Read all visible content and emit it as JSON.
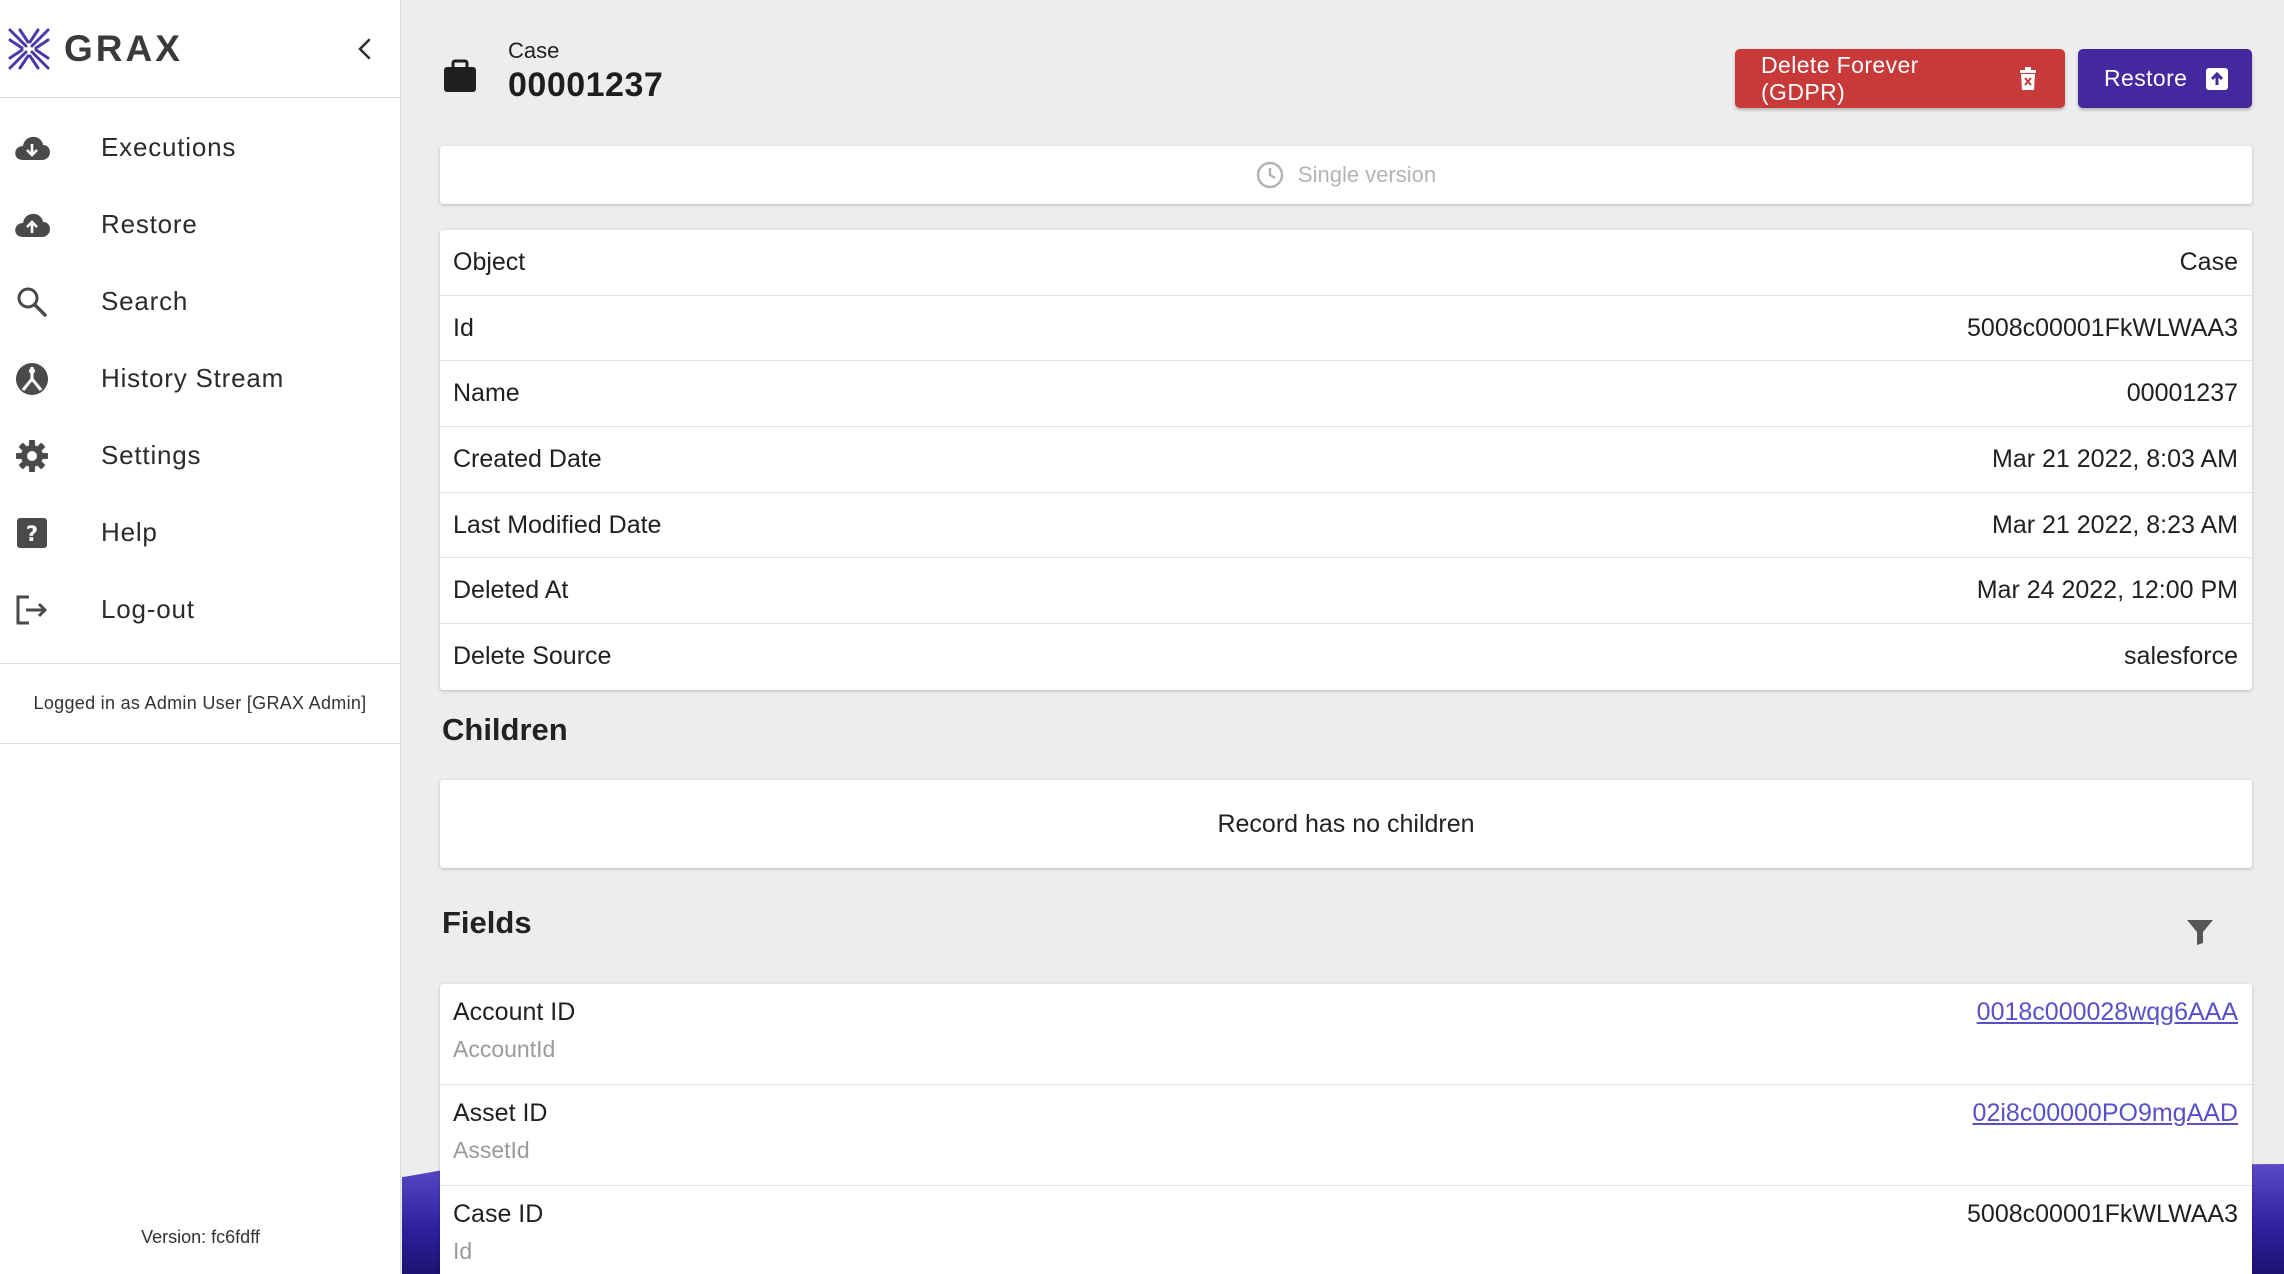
{
  "app": {
    "name": "GRAX",
    "collapse_icon": "chevron-left-icon"
  },
  "nav": {
    "items": [
      {
        "label": "Executions",
        "icon": "cloud-download-icon"
      },
      {
        "label": "Restore",
        "icon": "cloud-upload-icon"
      },
      {
        "label": "Search",
        "icon": "search-icon"
      },
      {
        "label": "History Stream",
        "icon": "history-stream-icon"
      },
      {
        "label": "Settings",
        "icon": "gear-icon"
      },
      {
        "label": "Help",
        "icon": "help-icon"
      },
      {
        "label": "Log-out",
        "icon": "logout-icon"
      }
    ]
  },
  "session": {
    "logged_in_text": "Logged in as Admin User [GRAX Admin]",
    "version_text": "Version: fc6fdff"
  },
  "record": {
    "type_label": "Case",
    "name": "00001237",
    "icon": "briefcase-icon"
  },
  "actions": {
    "delete_label": "Delete Forever (GDPR)",
    "delete_icon": "trash-icon",
    "restore_label": "Restore",
    "restore_icon": "upload-box-icon"
  },
  "colors": {
    "delete": "#c8393a",
    "restore": "#44289f",
    "link": "#5a4fc9"
  },
  "version_bar": {
    "label": "Single version",
    "icon": "clock-icon"
  },
  "properties": [
    {
      "label": "Object",
      "value": "Case"
    },
    {
      "label": "Id",
      "value": "5008c00001FkWLWAA3"
    },
    {
      "label": "Name",
      "value": "00001237"
    },
    {
      "label": "Created Date",
      "value": "Mar 21 2022, 8:03 AM"
    },
    {
      "label": "Last Modified Date",
      "value": "Mar 21 2022, 8:23 AM"
    },
    {
      "label": "Deleted At",
      "value": "Mar 24 2022, 12:00 PM"
    },
    {
      "label": "Delete Source",
      "value": "salesforce"
    }
  ],
  "children": {
    "title": "Children",
    "empty_text": "Record has no children"
  },
  "fields": {
    "title": "Fields",
    "filter_icon": "filter-icon",
    "rows": [
      {
        "label": "Account ID",
        "api_name": "AccountId",
        "value": "0018c000028wqg6AAA",
        "is_link": true
      },
      {
        "label": "Asset ID",
        "api_name": "AssetId",
        "value": "02i8c00000PO9mgAAD",
        "is_link": true
      },
      {
        "label": "Case ID",
        "api_name": "Id",
        "value": "5008c00001FkWLWAA3",
        "is_link": false
      }
    ]
  }
}
